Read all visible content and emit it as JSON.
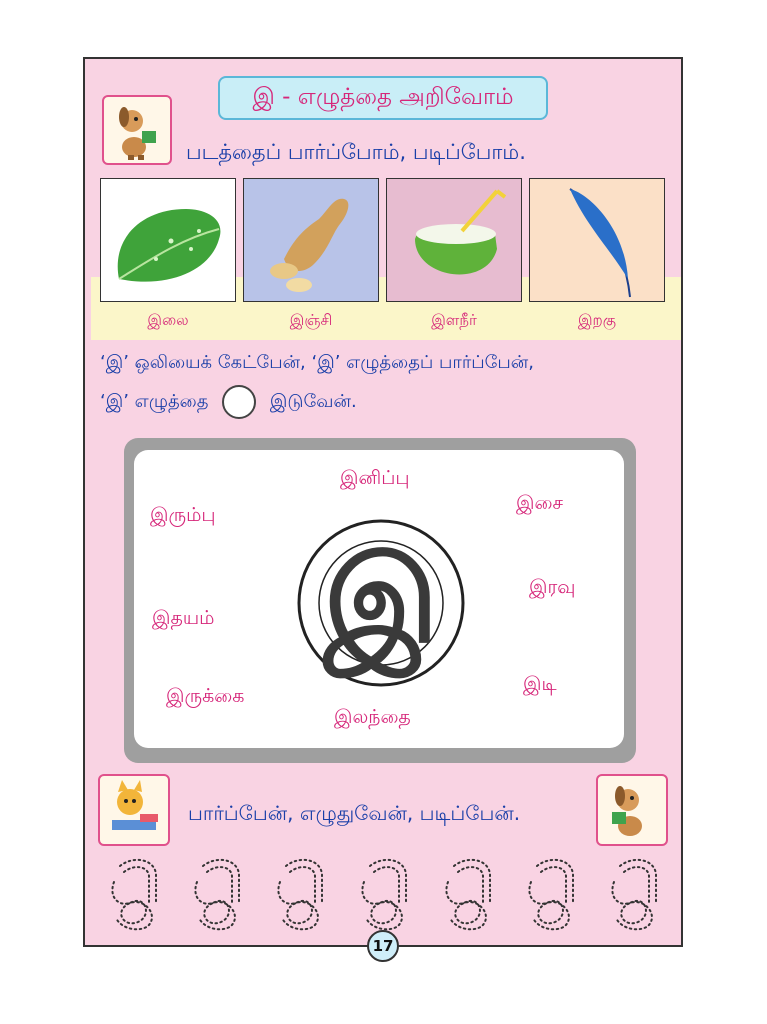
{
  "title": "இ - எழுத்தை அறிவோம்",
  "subtitle": "படத்தைப் பார்ப்போம், படிப்போம்.",
  "pictures": [
    {
      "caption": "இலை",
      "icon": "leaf-icon"
    },
    {
      "caption": "இஞ்சி",
      "icon": "ginger-icon"
    },
    {
      "caption": "இளநீர்",
      "icon": "coconut-icon"
    },
    {
      "caption": "இறகு",
      "icon": "feather-icon"
    }
  ],
  "instructions": {
    "line1": "‘இ’ ஒலியைக் கேட்பேன், ‘இ’ எழுத்தைப் பார்ப்பேன்,",
    "line2_start": "‘இ’ எழுத்தை",
    "line2_end": "இடுவேன்."
  },
  "center_letter": "இ",
  "words": [
    "இனிப்பு",
    "இசை",
    "இரும்பு",
    "இரவு",
    "இதயம்",
    "இடி",
    "இருக்கை",
    "இலந்தை"
  ],
  "bottom_text": "பார்ப்பேன், எழுதுவேன், படிப்பேன்.",
  "page_number": "17",
  "colors": {
    "page_bg": "#f9d3e3",
    "title_bg": "#c9eef7",
    "accent_pink": "#d6277a",
    "text_blue": "#1a3fa8"
  }
}
